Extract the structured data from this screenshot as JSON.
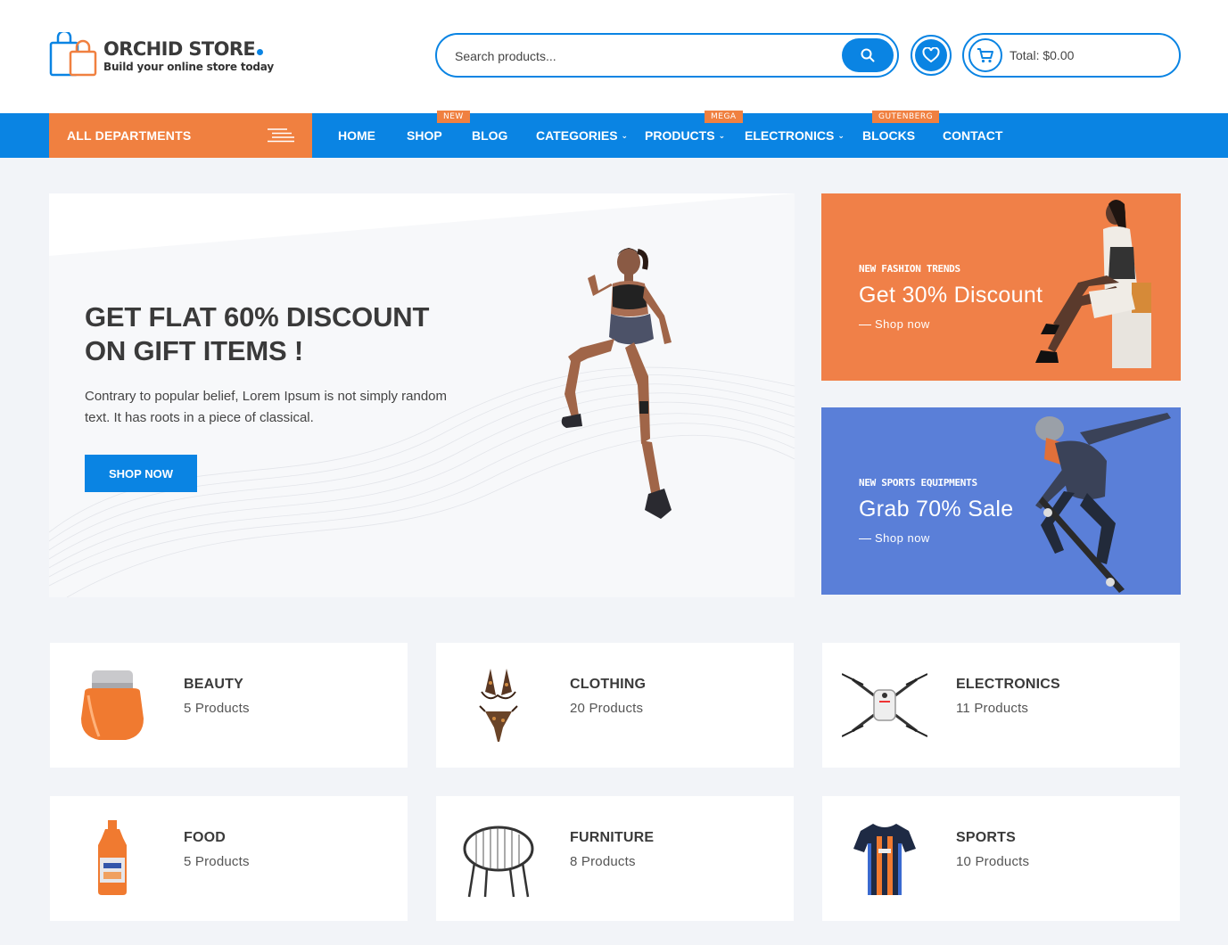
{
  "brand": {
    "name": "ORCHID STORE",
    "tagline": "Build your online store today"
  },
  "search": {
    "placeholder": "Search products..."
  },
  "cart": {
    "total": "Total: $0.00"
  },
  "nav": {
    "departments_label": "ALL DEPARTMENTS",
    "items": [
      {
        "label": "HOME"
      },
      {
        "label": "SHOP",
        "badge": "NEW"
      },
      {
        "label": "BLOG"
      },
      {
        "label": "CATEGORIES"
      },
      {
        "label": "PRODUCTS",
        "badge": "MEGA"
      },
      {
        "label": "ELECTRONICS"
      },
      {
        "label": "BLOCKS",
        "badge": "GUTENBERG"
      },
      {
        "label": "CONTACT"
      }
    ]
  },
  "hero": {
    "title_line1": "GET FLAT 60% DISCOUNT",
    "title_line2": "ON GIFT ITEMS !",
    "desc_line1": "Contrary to popular belief, Lorem Ipsum is not simply random",
    "desc_line2": "text. It has roots in a piece of classical.",
    "button": "SHOP NOW"
  },
  "promos": [
    {
      "kicker": "NEW FASHION TRENDS",
      "title": "Get 30% Discount",
      "link": "Shop now",
      "bg": "#f08048"
    },
    {
      "kicker": "NEW SPORTS EQUIPMENTS",
      "title": "Grab 70% Sale",
      "link": "Shop now",
      "bg": "#5a7fd8"
    }
  ],
  "categories": [
    {
      "name": "BEAUTY",
      "count": "5 Products",
      "icon": "cream-jar-icon"
    },
    {
      "name": "CLOTHING",
      "count": "20 Products",
      "icon": "bikini-icon"
    },
    {
      "name": "ELECTRONICS",
      "count": "11 Products",
      "icon": "drone-icon"
    },
    {
      "name": "FOOD",
      "count": "5 Products",
      "icon": "oil-bottle-icon"
    },
    {
      "name": "FURNITURE",
      "count": "8 Products",
      "icon": "chair-icon"
    },
    {
      "name": "SPORTS",
      "count": "10 Products",
      "icon": "jersey-icon"
    }
  ],
  "colors": {
    "primary": "#0a84e3",
    "accent": "#f08040",
    "page_bg": "#f2f4f8"
  }
}
